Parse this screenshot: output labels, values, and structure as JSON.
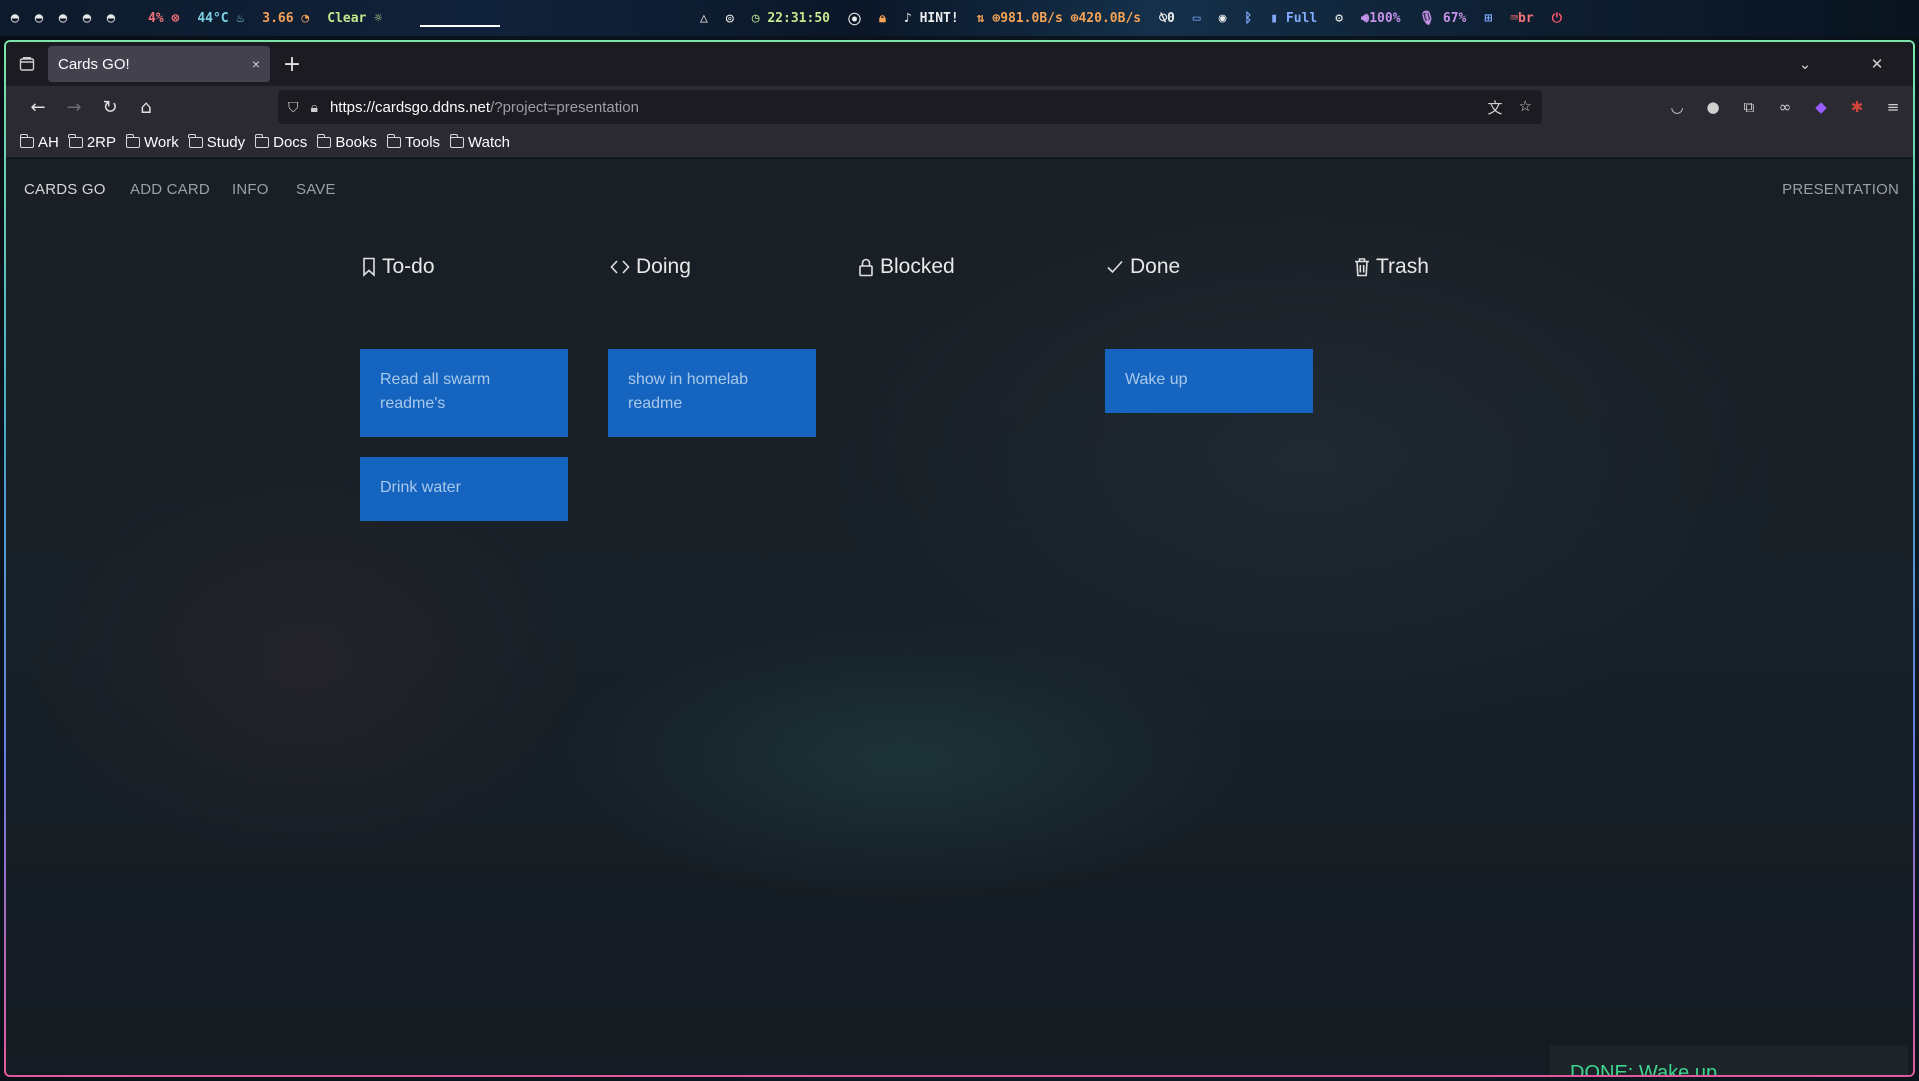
{
  "statusbar": {
    "cpu": "4%",
    "temp": "44°C",
    "load": "3.66",
    "weather": "Clear",
    "clock": "22:31:50",
    "hint": "HINT!",
    "net_down": "981.0B/s",
    "net_up": "420.0B/s",
    "notifications": "0",
    "battery": "Full",
    "volume": "100%",
    "mic": "67%",
    "keyboard": "br"
  },
  "browser": {
    "tab_title": "Cards GO!",
    "tab_close": "×",
    "new_tab": "+",
    "url_host": "https://cardsgo.ddns.net",
    "url_path": "/?project=presentation",
    "bookmarks": [
      "AH",
      "2RP",
      "Work",
      "Study",
      "Docs",
      "Books",
      "Tools",
      "Watch"
    ]
  },
  "app": {
    "brand": "CARDS GO",
    "nav": {
      "add_card": "ADD CARD",
      "info": "INFO",
      "save": "SAVE",
      "project": "PRESENTATION"
    },
    "columns": [
      {
        "title": "To-do",
        "icon": "bookmark-icon",
        "cards": [
          "Read all swarm readme's",
          "Drink water"
        ]
      },
      {
        "title": "Doing",
        "icon": "code-icon",
        "cards": [
          "show in homelab readme"
        ]
      },
      {
        "title": "Blocked",
        "icon": "lock-icon",
        "cards": []
      },
      {
        "title": "Done",
        "icon": "check-icon",
        "cards": [
          "Wake up"
        ]
      },
      {
        "title": "Trash",
        "icon": "trash-icon",
        "cards": []
      }
    ],
    "toast": "DONE: Wake up"
  },
  "colors": {
    "card": "#1565c0",
    "card_text": "#a9c8ea",
    "toast_text": "#3dd68c"
  }
}
